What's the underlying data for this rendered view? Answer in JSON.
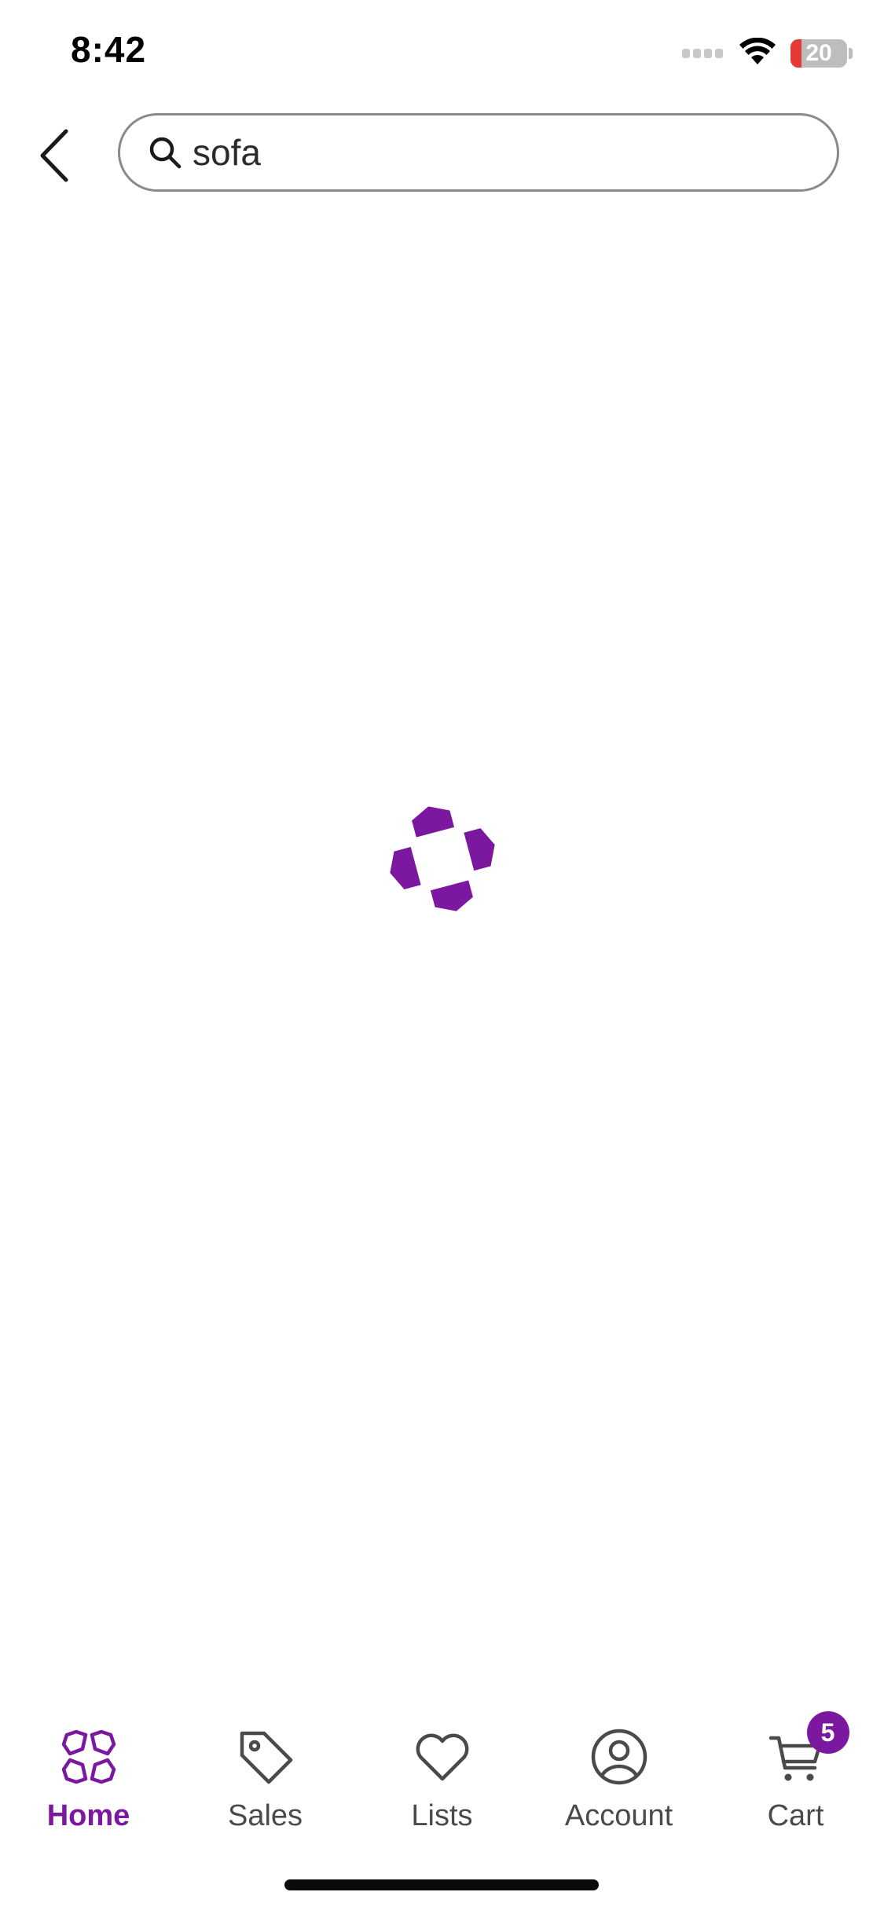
{
  "status_bar": {
    "time": "8:42",
    "battery_level": "20",
    "battery_fraction": 0.2
  },
  "search": {
    "value": "sofa",
    "placeholder": ""
  },
  "loading": {
    "icon": "wayfair-spinner-icon",
    "color": "#7b189f"
  },
  "tabs": [
    {
      "label": "Home",
      "icon": "home-icon",
      "active": true
    },
    {
      "label": "Sales",
      "icon": "tag-icon",
      "active": false
    },
    {
      "label": "Lists",
      "icon": "heart-icon",
      "active": false
    },
    {
      "label": "Account",
      "icon": "account-icon",
      "active": false
    },
    {
      "label": "Cart",
      "icon": "cart-icon",
      "active": false,
      "badge": "5"
    }
  ],
  "colors": {
    "accent": "#7b189f",
    "tab_inactive": "#4a4a4a",
    "search_border": "#8a8a8a"
  }
}
